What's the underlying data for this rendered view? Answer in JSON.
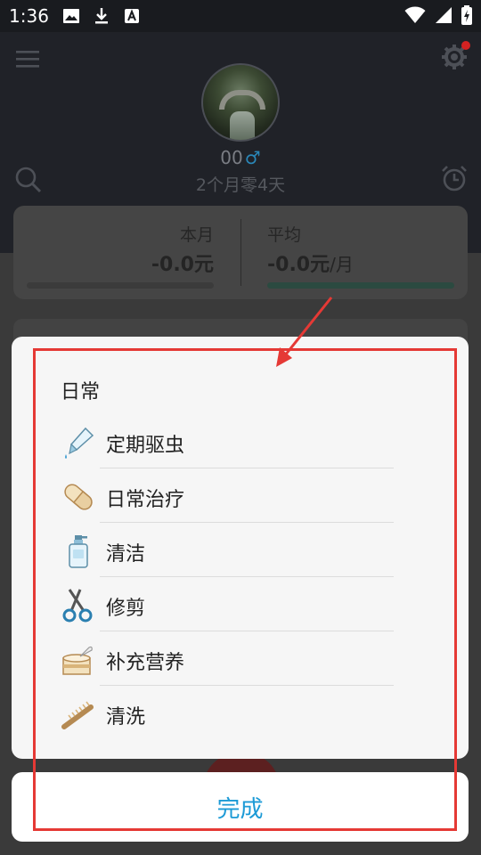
{
  "status_bar": {
    "time": "1:36"
  },
  "header": {
    "pet_name": "00",
    "gender_symbol": "♂",
    "pet_age": "2个月零4天"
  },
  "stats": {
    "this_month_label": "本月",
    "this_month_value": "-0.0元",
    "average_label": "平均",
    "average_value": "-0.0元",
    "average_unit": "/月"
  },
  "sheet": {
    "section_title": "日常",
    "items": [
      {
        "label": "定期驱虫",
        "icon": "dropper-icon"
      },
      {
        "label": "日常治疗",
        "icon": "pill-icon"
      },
      {
        "label": "清洁",
        "icon": "shampoo-bottle-icon"
      },
      {
        "label": "修剪",
        "icon": "scissors-icon"
      },
      {
        "label": "补充营养",
        "icon": "food-can-icon"
      },
      {
        "label": "清洗",
        "icon": "brush-icon"
      }
    ],
    "done_label": "完成"
  },
  "colors": {
    "accent": "#1c9ad6",
    "annotation_red": "#e53935",
    "gender_blue": "#2a87b8"
  }
}
